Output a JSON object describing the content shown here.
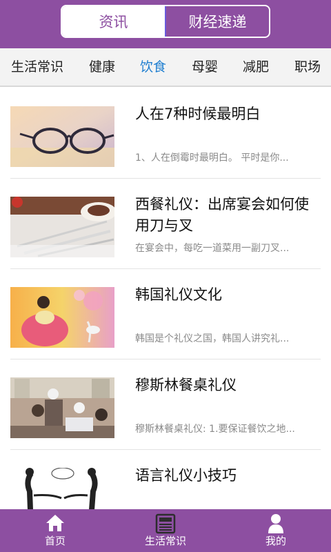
{
  "header": {
    "tabs": [
      {
        "label": "资讯"
      },
      {
        "label": "财经速递"
      }
    ]
  },
  "categories": [
    {
      "label": "生活常识"
    },
    {
      "label": "健康"
    },
    {
      "label": "饮食"
    },
    {
      "label": "母婴"
    },
    {
      "label": "减肥"
    },
    {
      "label": "职场"
    }
  ],
  "active_category": "饮食",
  "articles": [
    {
      "title": "人在7种时候最明白",
      "summary": "1、人在倒霉时最明白。 平时是你..."
    },
    {
      "title": "西餐礼仪：出席宴会如何使用刀与叉",
      "summary": "在宴会中，每吃一道菜用一副刀叉..."
    },
    {
      "title": "韩国礼仪文化",
      "summary": "韩国是个礼仪之国，韩国人讲究礼..."
    },
    {
      "title": "穆斯林餐桌礼仪",
      "summary": "穆斯林餐桌礼仪: 1.要保证餐饮之地..."
    },
    {
      "title": "语言礼仪小技巧",
      "summary": ""
    }
  ],
  "bottom_nav": [
    {
      "label": "首页",
      "icon": "home-icon"
    },
    {
      "label": "生活常识",
      "icon": "newspaper-icon"
    },
    {
      "label": "我的",
      "icon": "user-icon"
    }
  ],
  "colors": {
    "brand": "#8d4fa1",
    "active_category": "#1e7ed0",
    "summary_text": "#8a8a8a"
  }
}
